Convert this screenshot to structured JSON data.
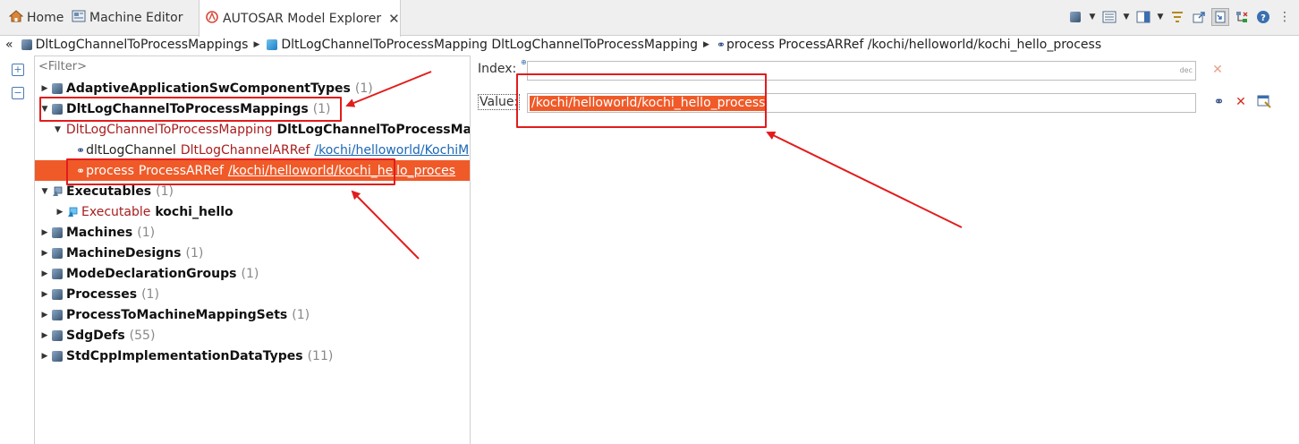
{
  "tabs": [
    {
      "label": "Home",
      "icon": "home-icon"
    },
    {
      "label": "Machine Editor",
      "icon": "editor-icon"
    },
    {
      "label": "AUTOSAR Model Explorer",
      "icon": "autosar-icon",
      "close": "✕"
    }
  ],
  "breadcrumb": [
    {
      "label": "DltLogChannelToProcessMappings"
    },
    {
      "label": "DltLogChannelToProcessMapping DltLogChannelToProcessMapping"
    },
    {
      "label": "process ProcessARRef /kochi/helloworld/kochi_hello_process"
    }
  ],
  "filter": {
    "placeholder": "<Filter>"
  },
  "tree": {
    "adaptive_app": {
      "name": "AdaptiveApplicationSwComponentTypes",
      "count": "(1)"
    },
    "dlt_mappings": {
      "name": "DltLogChannelToProcessMappings",
      "count": "(1)"
    },
    "dlt_mapping": {
      "type": "DltLogChannelToProcessMapping",
      "name": "DltLogChannelToProcessMa"
    },
    "dlt_channel": {
      "role": "dltLogChannel",
      "type": "DltLogChannelARRef",
      "ref": "/kochi/helloworld/KochiM"
    },
    "process_ref": {
      "role": "process",
      "type": "ProcessARRef",
      "ref": "/kochi/helloworld/kochi_hello_proces"
    },
    "executables": {
      "name": "Executables",
      "count": "(1)"
    },
    "executable": {
      "type": "Executable",
      "name": "kochi_hello"
    },
    "machines": {
      "name": "Machines",
      "count": "(1)"
    },
    "machine_designs": {
      "name": "MachineDesigns",
      "count": "(1)"
    },
    "mode_groups": {
      "name": "ModeDeclarationGroups",
      "count": "(1)"
    },
    "processes": {
      "name": "Processes",
      "count": "(1)"
    },
    "p2m_sets": {
      "name": "ProcessToMachineMappingSets",
      "count": "(1)"
    },
    "sdg_defs": {
      "name": "SdgDefs",
      "count": "(55)"
    },
    "stdcpp": {
      "name": "StdCppImplementationDataTypes",
      "count": "(11)"
    }
  },
  "properties": {
    "index_label": "Index:",
    "index_hint": "dec",
    "value_label": "Value:",
    "value": "/kochi/helloworld/kochi_hello_process"
  },
  "colors": {
    "selection": "#f05a28",
    "annotation": "#e21c1c"
  }
}
